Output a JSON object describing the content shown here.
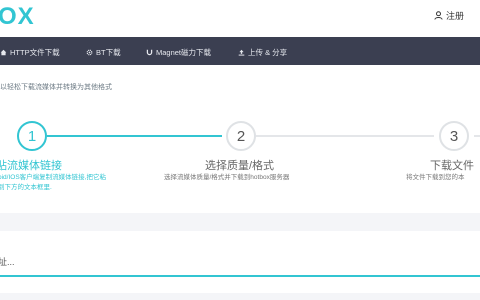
{
  "header": {
    "logo_text": "OX",
    "register_label": "注册",
    "register_icon": "user-icon",
    "accent_color": "#32c5d2"
  },
  "nav": {
    "background": "#3b3f51",
    "items": [
      {
        "label": "HTTP文件下载",
        "icon": "home-icon"
      },
      {
        "label": "BT下载",
        "icon": "gear-icon"
      },
      {
        "label": "Magnet磁力下载",
        "icon": "magnet-icon"
      },
      {
        "label": "上传 & 分享",
        "icon": "upload-icon"
      }
    ]
  },
  "intro_text": "以轻松下载流媒体并转换为其他格式",
  "steps": [
    {
      "number": "1",
      "title": "贴流媒体链接",
      "desc_lines": [
        "oid/IOS客户端复制流媒体链接,把它粘",
        "到下方的文本框里."
      ],
      "active": true
    },
    {
      "number": "2",
      "title": "选择质量/格式",
      "desc_lines": [
        "选择流媒体质量/格式并下载到hotbox服务器"
      ],
      "active": false
    },
    {
      "number": "3",
      "title": "下载文件",
      "desc_lines": [
        "将文件下载到您的本"
      ],
      "active": false
    }
  ],
  "url_input": {
    "placeholder": "址..."
  }
}
